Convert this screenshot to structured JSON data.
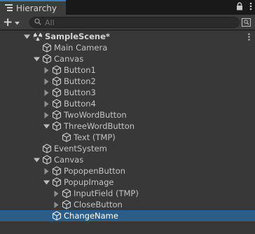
{
  "window": {
    "tab_title": "Hierarchy"
  },
  "toolbar": {
    "search_placeholder": "All"
  },
  "tree": {
    "scene": {
      "label": "SampleScene*",
      "expanded": true
    },
    "rows": [
      {
        "label": "Main Camera",
        "depth": 1,
        "has_children": false,
        "expanded": false,
        "selected": false
      },
      {
        "label": "Canvas",
        "depth": 1,
        "has_children": true,
        "expanded": true,
        "selected": false
      },
      {
        "label": "Button1",
        "depth": 2,
        "has_children": true,
        "expanded": false,
        "selected": false
      },
      {
        "label": "Button2",
        "depth": 2,
        "has_children": true,
        "expanded": false,
        "selected": false
      },
      {
        "label": "Button3",
        "depth": 2,
        "has_children": true,
        "expanded": false,
        "selected": false
      },
      {
        "label": "Button4",
        "depth": 2,
        "has_children": true,
        "expanded": false,
        "selected": false
      },
      {
        "label": "TwoWordButton",
        "depth": 2,
        "has_children": true,
        "expanded": false,
        "selected": false
      },
      {
        "label": "ThreeWordButton",
        "depth": 2,
        "has_children": true,
        "expanded": true,
        "selected": false
      },
      {
        "label": "Text (TMP)",
        "depth": 3,
        "has_children": false,
        "expanded": false,
        "selected": false
      },
      {
        "label": "EventSystem",
        "depth": 1,
        "has_children": false,
        "expanded": false,
        "selected": false
      },
      {
        "label": "Canvas",
        "depth": 1,
        "has_children": true,
        "expanded": true,
        "selected": false
      },
      {
        "label": "PopopenButton",
        "depth": 2,
        "has_children": true,
        "expanded": false,
        "selected": false
      },
      {
        "label": "PopupImage",
        "depth": 2,
        "has_children": true,
        "expanded": true,
        "selected": false
      },
      {
        "label": "InputField (TMP)",
        "depth": 3,
        "has_children": true,
        "expanded": false,
        "selected": false
      },
      {
        "label": "CloseButton",
        "depth": 3,
        "has_children": true,
        "expanded": false,
        "selected": false
      },
      {
        "label": "ChangeName",
        "depth": 2,
        "has_children": false,
        "expanded": false,
        "selected": true
      }
    ]
  },
  "colors": {
    "selection": "#2c5d87",
    "tab_accent": "#3a79bb",
    "panel_bg": "#383838",
    "text": "#c4c4c4"
  }
}
